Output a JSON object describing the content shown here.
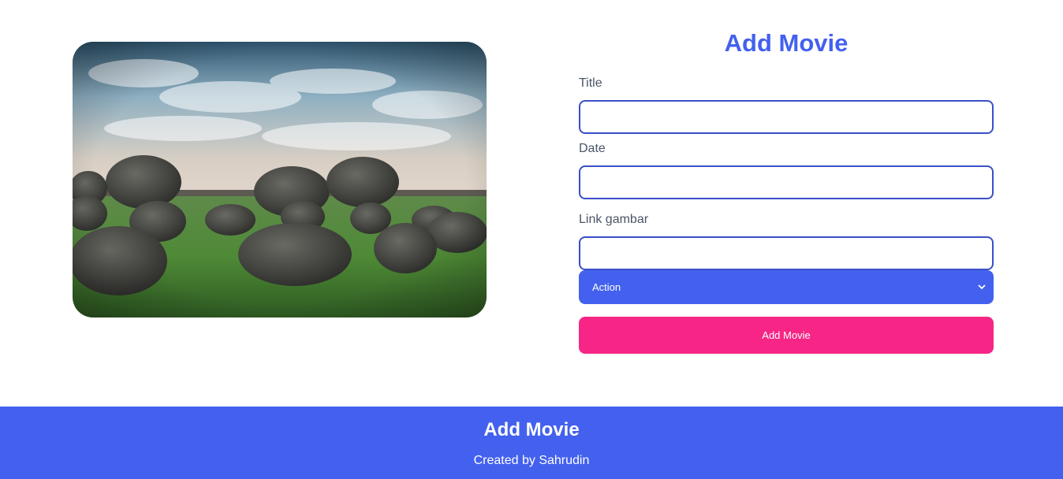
{
  "form": {
    "title": "Add Movie",
    "fields": [
      {
        "label": "Title",
        "value": "",
        "placeholder": ""
      },
      {
        "label": "Date",
        "value": "",
        "placeholder": ""
      },
      {
        "label": "Link gambar",
        "value": "",
        "placeholder": ""
      }
    ],
    "genre_selected": "Action",
    "submit_label": "Add Movie"
  },
  "image": {
    "subject": "stones-on-grass-landscape"
  },
  "footer": {
    "title": "Add Movie",
    "credit": "Created by Sahrudin"
  },
  "colors": {
    "accent": "#4361ee",
    "button": "#f72585",
    "input_border": "#3a4fc8",
    "label": "#4a5568"
  }
}
